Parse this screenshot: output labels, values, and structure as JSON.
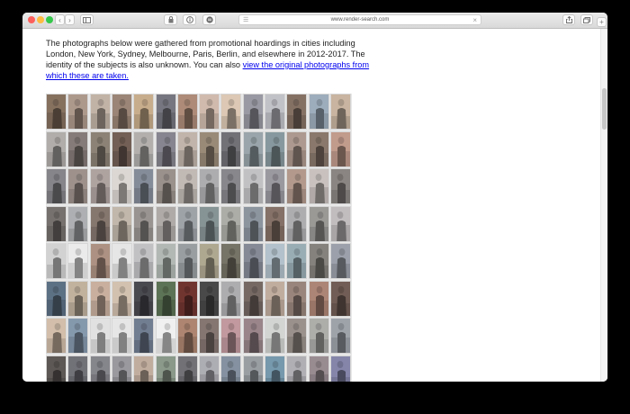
{
  "browser": {
    "url": "www.render-search.com",
    "page_icon": "page-icon",
    "nav_back": "‹",
    "nav_forward": "›"
  },
  "page": {
    "intro_text": "The photographs below were gathered from promotional hoardings in cities including London, New York, Sydney, Melbourne, Paris, Berlin, and elsewhere in 2012-2017. The identity of the subjects is also unknown. You can also ",
    "link_text": "view the original photographs from which these are taken.",
    "photo_grid": {
      "columns": 14,
      "rows": 8,
      "cells": [
        [
          "#6b5a4c",
          "#8a7a70",
          "#9a8f85",
          "#7c6a5e",
          "#a08a70",
          "#5e5e66",
          "#8a6f60",
          "#a6958a",
          "#b0a090",
          "#7a7a82",
          "#9a9aa0",
          "#6a5a50",
          "#7e8a96",
          "#a09080"
        ],
        [
          "#8d8a88",
          "#6a6260",
          "#70685e",
          "#5c4c44",
          "#8e8c8a",
          "#6c6a72",
          "#9a9088",
          "#7a6e60",
          "#5a5a5e",
          "#7a8488",
          "#6c7a7e",
          "#8a7a72",
          "#6e6056",
          "#9a7c70"
        ],
        [
          "#6a6a6e",
          "#7e7470",
          "#8c8280",
          "#b0aca8",
          "#6a707a",
          "#7c7470",
          "#9a9490",
          "#8a8a8c",
          "#6c6c70",
          "#9a9a9c",
          "#7c7a80",
          "#8e7a70",
          "#a09a98",
          "#6e6a68"
        ],
        [
          "#5e5a58",
          "#8a8c8e",
          "#6a5e58",
          "#9a9288",
          "#7a7674",
          "#8c8886",
          "#7e8286",
          "#6c7678",
          "#8a8a86",
          "#70767e",
          "#6a5a52",
          "#8a8a8c",
          "#7c7a78",
          "#9a9698"
        ],
        [
          "#a8a8a8",
          "#bcbcbc",
          "#8a7468",
          "#b8b8b8",
          "#9a9a9c",
          "#8e9490",
          "#7a7e80",
          "#8c8674",
          "#5e5c52",
          "#6a6e78",
          "#8e9aa2",
          "#7a8a90",
          "#6a6864",
          "#7c8088"
        ],
        [
          "#4a5a6a",
          "#9a8e7e",
          "#a08c7e",
          "#a89a8c",
          "#3a3a40",
          "#4a5c44",
          "#5a2a26",
          "#3a3a3a",
          "#8a8a8c",
          "#5e5450",
          "#9a8a7e",
          "#7a6a62",
          "#8a6a5e",
          "#5a4a44"
        ],
        [
          "#a89888",
          "#6a7a8a",
          "#b4b4b4",
          "#b8b8b8",
          "#5a6474",
          "#c0c0c0",
          "#8a6a5a",
          "#6a5e5a",
          "#9a7a7e",
          "#7a6a6e",
          "#a8aaa8",
          "#7c7470",
          "#8a8a88",
          "#7e8288"
        ],
        [
          "#4a4644",
          "#5a5a60",
          "#6a6a70",
          "#7a7a7e",
          "#9a8a7e",
          "#6e7a6e",
          "#5a5a5e",
          "#8a8a90",
          "#6a7480",
          "#7a7e82",
          "#5e7a8a",
          "#8c8c90",
          "#7a7074",
          "#6a6a88"
        ]
      ]
    }
  }
}
